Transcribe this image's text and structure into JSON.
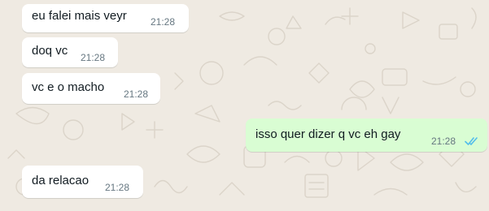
{
  "chat": {
    "messages": [
      {
        "direction": "incoming",
        "text": "eu falei mais veyr",
        "time": "21:28"
      },
      {
        "direction": "incoming",
        "text": "doq vc",
        "time": "21:28"
      },
      {
        "direction": "incoming",
        "text": "vc e o macho",
        "time": "21:28"
      },
      {
        "direction": "outgoing",
        "text": "isso quer dizer q vc eh gay",
        "time": "21:28",
        "status": "read"
      },
      {
        "direction": "incoming",
        "text": "da relacao",
        "time": "21:28"
      }
    ]
  },
  "colors": {
    "wallpaper": "#efeae2",
    "incoming_bubble": "#ffffff",
    "outgoing_bubble": "#d9fdd3",
    "message_text": "#111b21",
    "timestamp": "#667781",
    "read_ticks": "#53bdeb"
  },
  "icons": {
    "read_receipt": "double-check-icon"
  }
}
